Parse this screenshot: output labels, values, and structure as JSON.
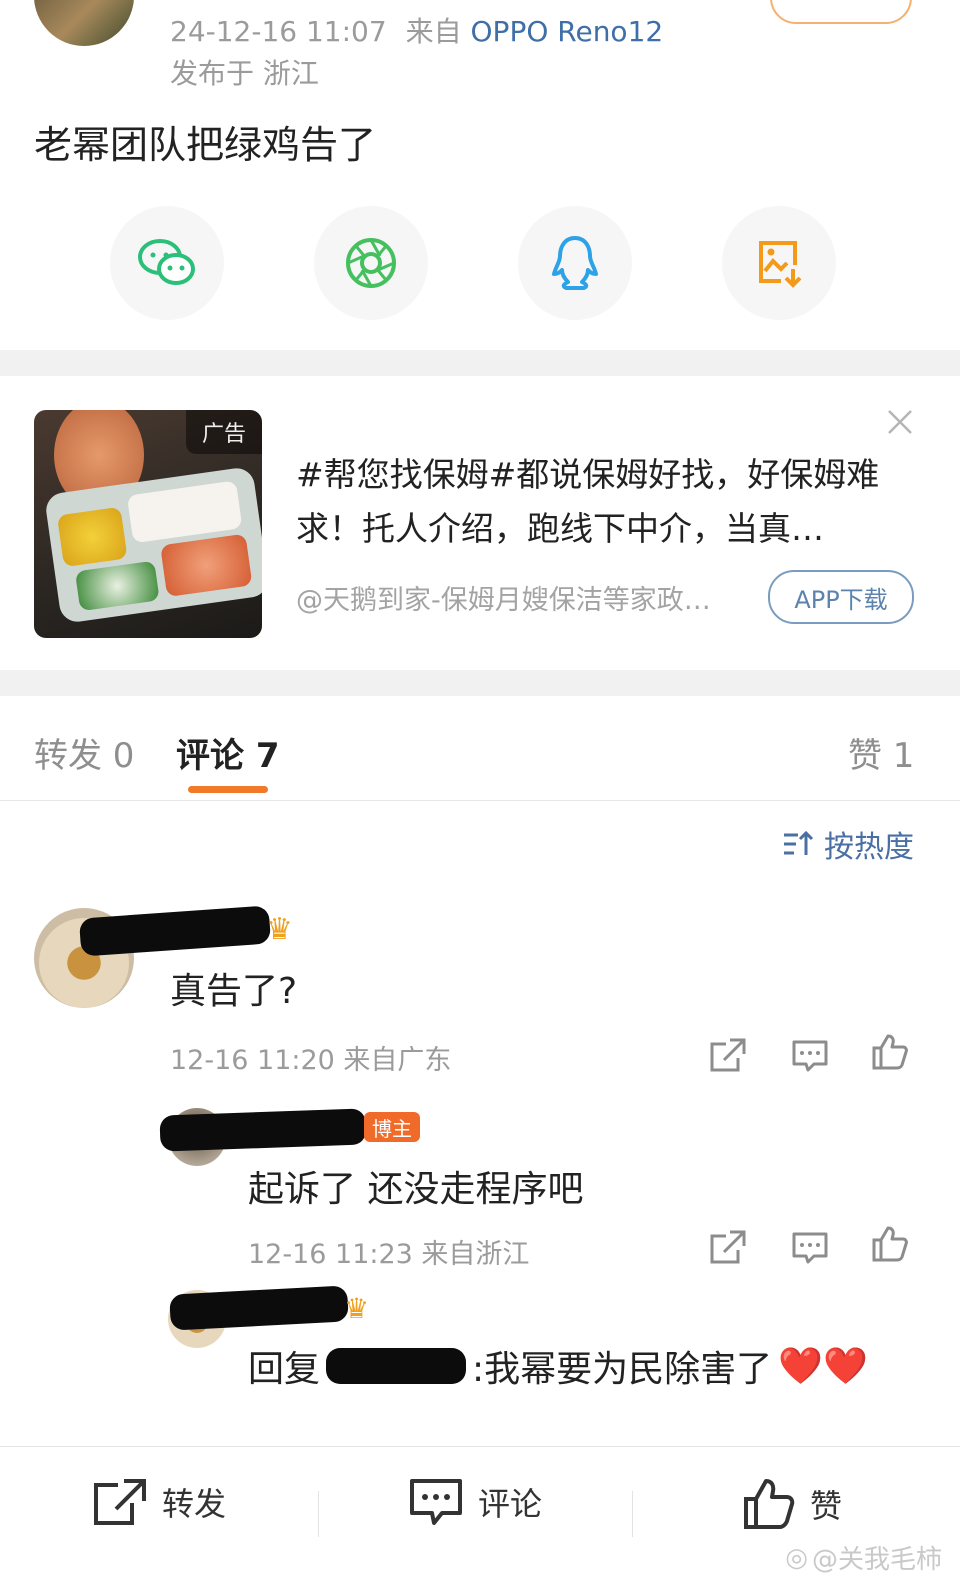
{
  "post": {
    "meta_time": "24-12-16 11:07",
    "meta_from": "来自",
    "meta_device": "OPPO Reno12",
    "location": "发布于 浙江",
    "text": "老幂团队把绿鸡告了"
  },
  "share": {
    "items": [
      {
        "name": "wechat",
        "color": "#2bbf7a"
      },
      {
        "name": "moments",
        "color": "#44c05f"
      },
      {
        "name": "qq",
        "color": "#2ea2e6"
      },
      {
        "name": "save-image",
        "color": "#f39a1b"
      }
    ]
  },
  "ad": {
    "badge": "广告",
    "title": "#帮您找保姆#都说保姆好找，好保姆难求！托人介绍，跑线下中介，当真…",
    "source": "@天鹅到家-保姆月嫂保洁等家政…",
    "button": "APP下载"
  },
  "tabs": {
    "repost": "转发 0",
    "comment": "评论 7",
    "like": "赞 1",
    "accent": "#f07a2a"
  },
  "sort": {
    "label": "按热度"
  },
  "comments": [
    {
      "text": "真告了?",
      "time": "12-16 11:20 来自广东"
    },
    {
      "badge": "博主",
      "text": "起诉了 还没走程序吧",
      "time": "12-16 11:23 来自浙江"
    },
    {
      "text_prefix": "回复",
      "text_body": ":我幂要为民除害了",
      "hearts": "❤️❤️"
    }
  ],
  "bottom_bar": {
    "repost": "转发",
    "comment": "评论",
    "like": "赞"
  },
  "watermark": "@关我毛柿"
}
